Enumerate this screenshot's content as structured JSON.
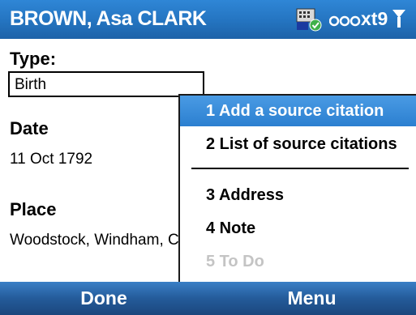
{
  "titlebar": {
    "title": "BROWN, Asa CLARK",
    "status_icons": [
      "network-icon",
      "input-mode-icon",
      "signal-icon"
    ],
    "input_mode": "xt9"
  },
  "form": {
    "type_label": "Type:",
    "type_value": "Birth",
    "date_label": "Date",
    "date_value": "11 Oct 1792",
    "place_label": "Place",
    "place_value": "Woodstock, Windham, C"
  },
  "menu": {
    "items": [
      {
        "label": "1 Add a source citation",
        "selected": true,
        "enabled": true
      },
      {
        "label": "2 List of source citations",
        "selected": false,
        "enabled": true
      },
      {
        "label": "3 Address",
        "selected": false,
        "enabled": true
      },
      {
        "label": "4 Note",
        "selected": false,
        "enabled": true
      },
      {
        "label": "5 To Do",
        "selected": false,
        "enabled": false
      }
    ]
  },
  "softkeys": {
    "left": "Done",
    "right": "Menu"
  },
  "colors": {
    "titlebar": "#2474c0",
    "selection": "#3a8dda",
    "softbar": "#245b9a",
    "disabled_text": "#c4c4c4"
  }
}
